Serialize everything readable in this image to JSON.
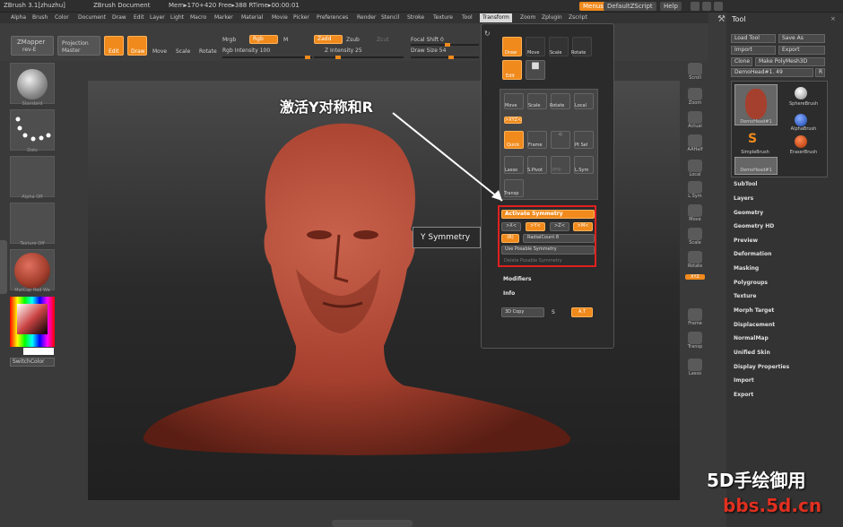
{
  "titlebar": {
    "app": "ZBrush 3.1[zhuzhu]",
    "doc": "ZBrush Document",
    "mem": "Mem▸170+420 Free▸388 RTime▸00:00:01",
    "menus": "Menus",
    "script": "DefaultZScript",
    "help": "Help"
  },
  "menubar": [
    "Alpha",
    "Brush",
    "Color",
    "Document",
    "Draw",
    "Edit",
    "Layer",
    "Light",
    "Macro",
    "Marker",
    "Material",
    "Movie",
    "Picker",
    "Preferences",
    "Render",
    "Stencil",
    "Stroke",
    "Texture",
    "Tool",
    "Transform",
    "Zoom",
    "Zplugin",
    "Zscript"
  ],
  "toolbar": {
    "zmapper": "ZMapper",
    "zmapper_sub": "rev-E",
    "projection": "Projection",
    "projection_sub": "Master",
    "edit": "Edit",
    "draw": "Draw",
    "move": "Move",
    "scale": "Scale",
    "rotate": "Rotate",
    "mrgb": "Mrgb",
    "rgb": "Rgb",
    "m": "M",
    "rgb_intensity": "Rgb Intensity 100",
    "zadd": "Zadd",
    "zsub": "Zsub",
    "zcut": "Zcut",
    "z_intensity": "Z Intensity 25",
    "focal_shift": "Focal Shift 0",
    "draw_size": "Draw Size 54"
  },
  "leftshelf": {
    "tiles": [
      "Standard",
      "Dots",
      "Alpha Off",
      "Texture Off",
      "MatCap Red Wa"
    ],
    "switch_color": "SwitchColor"
  },
  "transform": {
    "draw": "Draw",
    "move": "Move",
    "scale": "Scale",
    "rotate": "Rotate",
    "edit": "Edit",
    "move2": "Move",
    "scale2": "Scale",
    "rotate2": "Rotate",
    "local": "Local",
    "xyz": ">XYZ<",
    "quick": "Quick",
    "frame": "Frame",
    "ptsel": "Pt Sel",
    "lasso": "Lasso",
    "spivot": "S.Pivot",
    "pfill": "PFill",
    "lsym": "L.Sym",
    "transp": "Transp",
    "activate_symmetry": "Activate Symmetry",
    "x": ">X<",
    "y": ">Y<",
    "z": ">Z<",
    "m": ">M<",
    "r": "(R)",
    "radial_count": "RadialCount 8",
    "use_posable": "Use Posable Symmetry",
    "delete_posable": "Delete Posable Symmetry",
    "modifiers": "Modifiers",
    "info": "Info",
    "copy3d": "3D Copy",
    "s": "S",
    "at": "A.T"
  },
  "tooltip": "Y Symmetry",
  "annotation": "激活Y对称和R",
  "rightshelf": [
    "Scroll",
    "Zoom",
    "Actual",
    "AAHalf",
    "Local",
    "L.Sym",
    "Move",
    "Scale",
    "Rotate",
    "XYZ",
    "Frame",
    "Transp",
    "Lasso"
  ],
  "tool": {
    "title": "Tool",
    "load": "Load Tool",
    "save": "Save As",
    "import": "Import",
    "export": "Export",
    "clone": "Clone",
    "make": "Make PolyMesh3D",
    "current": "DemoHead#1. 49",
    "r": "R",
    "brushes": [
      "DemoHead#1",
      "SphereBrush",
      "AlphaBrush",
      "SimpleBrush",
      "EraserBrush",
      "DemoHead#1"
    ],
    "sections": [
      "SubTool",
      "Layers",
      "Geometry",
      "Geometry HD",
      "Preview",
      "Deformation",
      "Masking",
      "Polygroups",
      "Texture",
      "Morph Target",
      "Displacement",
      "NormalMap",
      "Unified Skin",
      "Display Properties",
      "Import",
      "Export"
    ]
  },
  "watermark": {
    "line1": "5D手绘御用",
    "line2": "bbs.5d.cn"
  },
  "colors": {
    "accent": "#f08a1c",
    "highlight": "#e02020",
    "skin": "#a6402e"
  }
}
